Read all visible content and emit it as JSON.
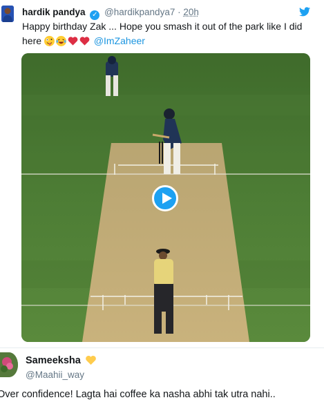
{
  "tweet": {
    "author_name": "hardik pandya",
    "author_handle": "@hardikpandya7",
    "separator": "·",
    "time": "20h",
    "text": "Happy birthday Zak ... Hope you smash it out of the park like I did here",
    "mention": "@ImZaheer",
    "icons": [
      "verified-badge-icon",
      "twitter-bird-icon",
      "play-icon"
    ],
    "accent_color": "#1da1f2"
  },
  "reply": {
    "name": "Sameeksha",
    "handle": "@Maahii_way",
    "text": "Over confidence! Lagta hai coffee ka nasha abhi tak utra nahi.."
  }
}
